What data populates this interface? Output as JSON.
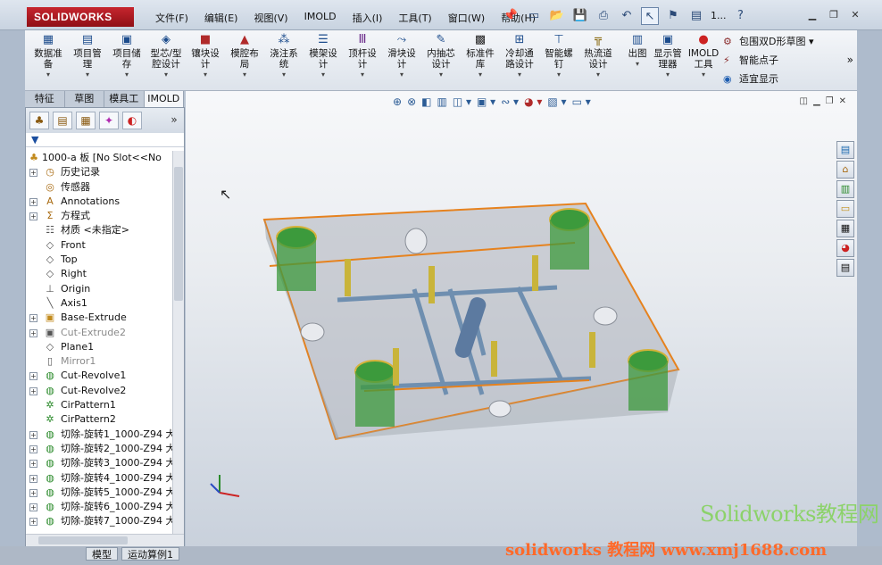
{
  "app": {
    "logo": "SOLIDWORKS"
  },
  "menu": [
    "文件(F)",
    "编辑(E)",
    "视图(V)",
    "IMOLD",
    "插入(I)",
    "工具(T)",
    "窗口(W)",
    "帮助(H)"
  ],
  "quick_access": {
    "counter": "1..."
  },
  "ribbon": {
    "buttons": [
      "数据准备",
      "项目管理",
      "项目储存",
      "型芯/型腔设计",
      "镶块设计",
      "模腔布局",
      "浇注系统",
      "模架设计",
      "顶杆设计",
      "滑块设计",
      "内抽芯设计",
      "标准件库",
      "冷却通路设计",
      "智能螺钉",
      "热流道设计",
      "出图",
      "显示管理器",
      "IMOLD工具"
    ],
    "side": [
      "包围双D形草图",
      "智能点子",
      "适宜显示"
    ]
  },
  "tabs": [
    "特征",
    "草图",
    "模具工具",
    "IMOLD"
  ],
  "tree": {
    "root": "1000-a 板 [No Slot<<No",
    "items": [
      {
        "label": "历史记录",
        "icon": "history-icon",
        "expand": true,
        "gray": false
      },
      {
        "label": "传感器",
        "icon": "sensor-icon",
        "expand": false,
        "gray": false
      },
      {
        "label": "Annotations",
        "icon": "annotations-icon",
        "expand": true,
        "gray": false
      },
      {
        "label": "方程式",
        "icon": "equations-icon",
        "expand": true,
        "gray": false
      },
      {
        "label": "材质 <未指定>",
        "icon": "material-icon",
        "expand": false,
        "gray": false
      },
      {
        "label": "Front",
        "icon": "plane-icon",
        "expand": false,
        "gray": false
      },
      {
        "label": "Top",
        "icon": "plane-icon",
        "expand": false,
        "gray": false
      },
      {
        "label": "Right",
        "icon": "plane-icon",
        "expand": false,
        "gray": false
      },
      {
        "label": "Origin",
        "icon": "origin-icon",
        "expand": false,
        "gray": false
      },
      {
        "label": "Axis1",
        "icon": "axis-icon",
        "expand": false,
        "gray": false
      },
      {
        "label": "Base-Extrude",
        "icon": "extrude-icon",
        "expand": true,
        "gray": false
      },
      {
        "label": "Cut-Extrude2",
        "icon": "cut-extrude-icon",
        "expand": true,
        "gray": true
      },
      {
        "label": "Plane1",
        "icon": "plane-icon",
        "expand": false,
        "gray": false
      },
      {
        "label": "Mirror1",
        "icon": "mirror-icon",
        "expand": false,
        "gray": true
      },
      {
        "label": "Cut-Revolve1",
        "icon": "revolve-icon",
        "expand": true,
        "gray": false
      },
      {
        "label": "Cut-Revolve2",
        "icon": "revolve-icon",
        "expand": true,
        "gray": false
      },
      {
        "label": "CirPattern1",
        "icon": "pattern-icon",
        "expand": false,
        "gray": false
      },
      {
        "label": "CirPattern2",
        "icon": "pattern-icon",
        "expand": false,
        "gray": false
      },
      {
        "label": "切除-旋转1_1000-Z94 大",
        "icon": "revolve-icon",
        "expand": true,
        "gray": false
      },
      {
        "label": "切除-旋转2_1000-Z94 大",
        "icon": "revolve-icon",
        "expand": true,
        "gray": false
      },
      {
        "label": "切除-旋转3_1000-Z94 大",
        "icon": "revolve-icon",
        "expand": true,
        "gray": false
      },
      {
        "label": "切除-旋转4_1000-Z94 大",
        "icon": "revolve-icon",
        "expand": true,
        "gray": false
      },
      {
        "label": "切除-旋转5_1000-Z94 大",
        "icon": "revolve-icon",
        "expand": true,
        "gray": false
      },
      {
        "label": "切除-旋转6_1000-Z94 大",
        "icon": "revolve-icon",
        "expand": true,
        "gray": false
      },
      {
        "label": "切除-旋转7_1000-Z94 大",
        "icon": "revolve-icon",
        "expand": true,
        "gray": false
      }
    ]
  },
  "bottom_tabs": [
    "模型",
    "运动算例1"
  ],
  "watermark": {
    "top": "Solidworks教程网",
    "bottom": "solidworks 教程网 www.xmj1688.com"
  },
  "colors": {
    "accent": "#c6262e",
    "plate_outline": "#e6821e",
    "bushing": "#3c9a3c",
    "pin": "#c9b43a",
    "channel": "#6f8fb0"
  }
}
